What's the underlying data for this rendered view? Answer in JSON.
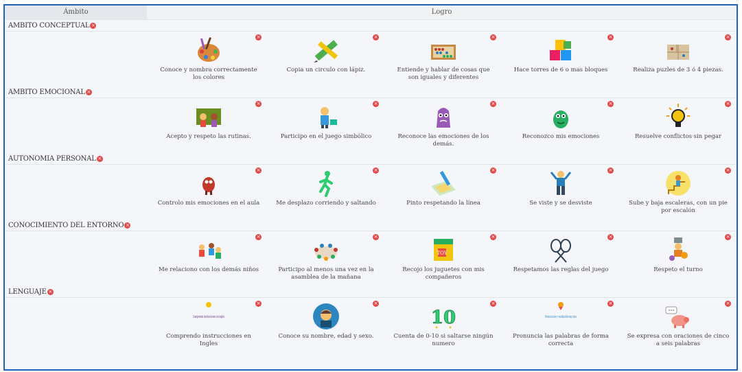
{
  "header": {
    "ambito": "Ámbito",
    "logro": "Logro"
  },
  "delete_icon_glyph": "×",
  "colors": {
    "border": "#1f63b8",
    "delete": "#e24a4a",
    "background": "#f4f6f9"
  },
  "sections": [
    {
      "title": "AMBITO CONCEPTUAL",
      "items": [
        {
          "label": "Conoce y nombra correctamente los colores",
          "icon": "paint-palette-icon"
        },
        {
          "label": "Copia un circulo con lápiz.",
          "icon": "pencil-ruler-icon"
        },
        {
          "label": "Entiende y hablar de cosas que son iguales y diferentes",
          "icon": "abacus-icon"
        },
        {
          "label": "Hace torres de 6 o mas bloques",
          "icon": "toy-blocks-icon"
        },
        {
          "label": "Realiza puzles de 3 ó 4 piezas.",
          "icon": "puzzle-icon"
        }
      ]
    },
    {
      "title": "AMBITO EMOCIONAL",
      "items": [
        {
          "label": "Acepto y respeto las rutinas.",
          "icon": "classroom-routine-icon"
        },
        {
          "label": "Participo en el juego simbólico",
          "icon": "doctor-play-icon"
        },
        {
          "label": "Reconoce las emociones de los demás.",
          "icon": "purple-monster-icon"
        },
        {
          "label": "Reconozco mis emociones",
          "icon": "green-monster-icon"
        },
        {
          "label": "Resuelve conflictos sin pegar",
          "icon": "lightbulb-icon"
        }
      ]
    },
    {
      "title": "AUTONOMIA PERSONAL",
      "items": [
        {
          "label": "Controlo mis emociones en el aula",
          "icon": "red-monster-icon"
        },
        {
          "label": "Me desplazo corriendo y saltando",
          "icon": "running-child-icon"
        },
        {
          "label": "Pinto respetando la línea",
          "icon": "coloring-page-icon"
        },
        {
          "label": "Se viste y se desviste",
          "icon": "dressing-child-icon"
        },
        {
          "label": "Sube y baja escaleras, con un pie por escalón",
          "icon": "stairs-child-icon"
        }
      ]
    },
    {
      "title": "CONOCIMIENTO DEL ENTORNO",
      "items": [
        {
          "label": "Me relaciono con los demás niños",
          "icon": "children-playing-icon"
        },
        {
          "label": "Participo al menos una vez en la asamblea de la mañana",
          "icon": "assembly-circle-icon"
        },
        {
          "label": "Recojo los juguetes con mis compañeros",
          "icon": "toy-box-icon"
        },
        {
          "label": "Respetamos las reglas del juego",
          "icon": "rackets-icon"
        },
        {
          "label": "Respeto el turno",
          "icon": "waiting-turn-icon"
        }
      ]
    },
    {
      "title": "LENGUAJE",
      "items": [
        {
          "label": "Comprendo instrucciones en Ingles",
          "icon": "english-badge-icon",
          "icon_text": "Comprende instrucciones en inglés"
        },
        {
          "label": "Conoce su nombre, edad y sexo.",
          "icon": "boy-portrait-icon"
        },
        {
          "label": "Cuenta de 0-10 si saltarse ningún numero",
          "icon": "number-ten-icon",
          "icon_text": "10"
        },
        {
          "label": "Pronuncia las palabras de forma correcta",
          "icon": "pronunciation-badge-icon",
          "icon_text": "Pronunciación y vocalización muy clara"
        },
        {
          "label": "Se expresa con oraciones de cinco a seis palabras",
          "icon": "speech-pig-icon"
        }
      ]
    }
  ]
}
